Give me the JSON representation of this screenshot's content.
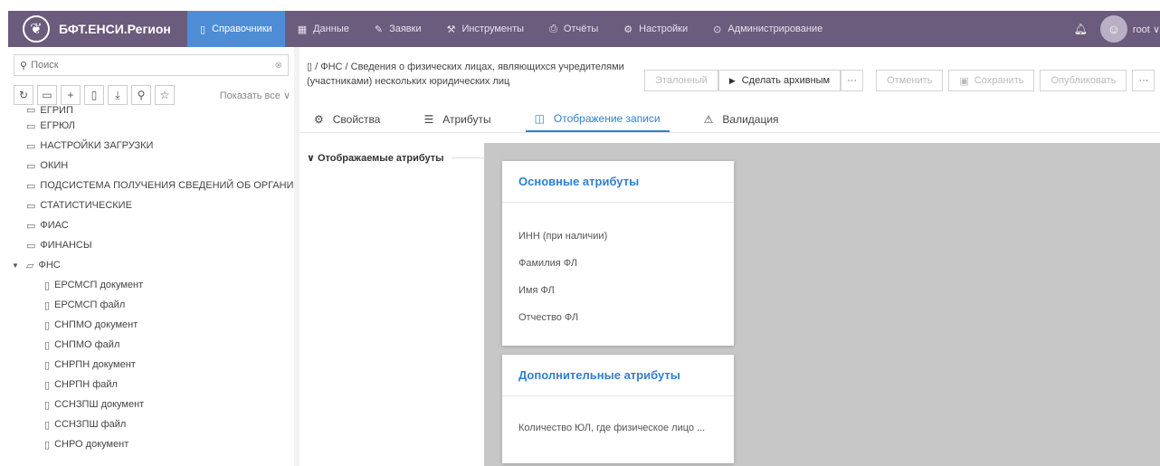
{
  "topbar": {
    "brand": "БФТ.ЕНСИ.Регион",
    "nav": [
      {
        "label": "Справочники",
        "icon": "book-icon",
        "active": true
      },
      {
        "label": "Данные",
        "icon": "grid-icon"
      },
      {
        "label": "Заявки",
        "icon": "edit-icon"
      },
      {
        "label": "Инструменты",
        "icon": "tools-icon"
      },
      {
        "label": "Отчёты",
        "icon": "printer-icon"
      },
      {
        "label": "Настройки",
        "icon": "gear-icon"
      },
      {
        "label": "Администрирование",
        "icon": "shield-check-icon"
      }
    ],
    "user": "root",
    "user_chevron": "∨"
  },
  "sidebar": {
    "search_placeholder": "Поиск",
    "show_all": "Показать все ∨",
    "tree": [
      {
        "label": "ЕГРИП",
        "kind": "folder"
      },
      {
        "label": "ЕГРЮЛ",
        "kind": "folder"
      },
      {
        "label": "НАСТРОЙКИ ЗАГРУЗКИ",
        "kind": "folder"
      },
      {
        "label": "ОКИН",
        "kind": "folder"
      },
      {
        "label": "ПОДСИСТЕМА ПОЛУЧЕНИЯ СВЕДЕНИЙ ОБ ОРГАНИ",
        "kind": "folder"
      },
      {
        "label": "СТАТИСТИЧЕСКИЕ",
        "kind": "folder"
      },
      {
        "label": "ФИАС",
        "kind": "folder"
      },
      {
        "label": "ФИНАНСЫ",
        "kind": "folder"
      },
      {
        "label": "ФНС",
        "kind": "folder-open"
      },
      {
        "label": "ЕРСМСП документ",
        "kind": "file"
      },
      {
        "label": "ЕРСМСП файл",
        "kind": "file"
      },
      {
        "label": "СНПМО документ",
        "kind": "file"
      },
      {
        "label": "СНПМО файл",
        "kind": "file"
      },
      {
        "label": "СНРПН документ",
        "kind": "file"
      },
      {
        "label": "СНРПН файл",
        "kind": "file"
      },
      {
        "label": "ССНЗПШ документ",
        "kind": "file"
      },
      {
        "label": "ССНЗПШ файл",
        "kind": "file"
      },
      {
        "label": "СНРО документ",
        "kind": "file"
      }
    ]
  },
  "main": {
    "breadcrumb": "/ ФНС / Сведения о физических лицах, являющихся учредителями (участниками) нескольких юридических лиц",
    "buttons": {
      "etalon": "Эталонный",
      "archive": "Сделать архивным",
      "more": "···",
      "cancel": "Отменить",
      "save": "Сохранить",
      "publish": "Опубликовать"
    },
    "tabs": [
      {
        "label": "Свойства",
        "icon": "gear-icon"
      },
      {
        "label": "Атрибуты",
        "icon": "list-icon"
      },
      {
        "label": "Отображение записи",
        "icon": "layout-icon",
        "active": true
      },
      {
        "label": "Валидация",
        "icon": "warning-icon"
      }
    ],
    "section_label": "∨ Отображаемые атрибуты",
    "cards": [
      {
        "title": "Основные атрибуты",
        "rows": [
          "ИНН (при наличии)",
          "Фамилия ФЛ",
          "Имя ФЛ",
          "Отчество ФЛ"
        ]
      },
      {
        "title": "Дополнительные атрибуты",
        "rows": [
          "Количество ЮЛ, где физическое лицо ..."
        ]
      }
    ]
  },
  "colors": {
    "topbar": "#6b5b7c",
    "accent": "#2f7fd2",
    "active_nav": "#4e8dd6",
    "canvas": "#c7c7c7"
  }
}
